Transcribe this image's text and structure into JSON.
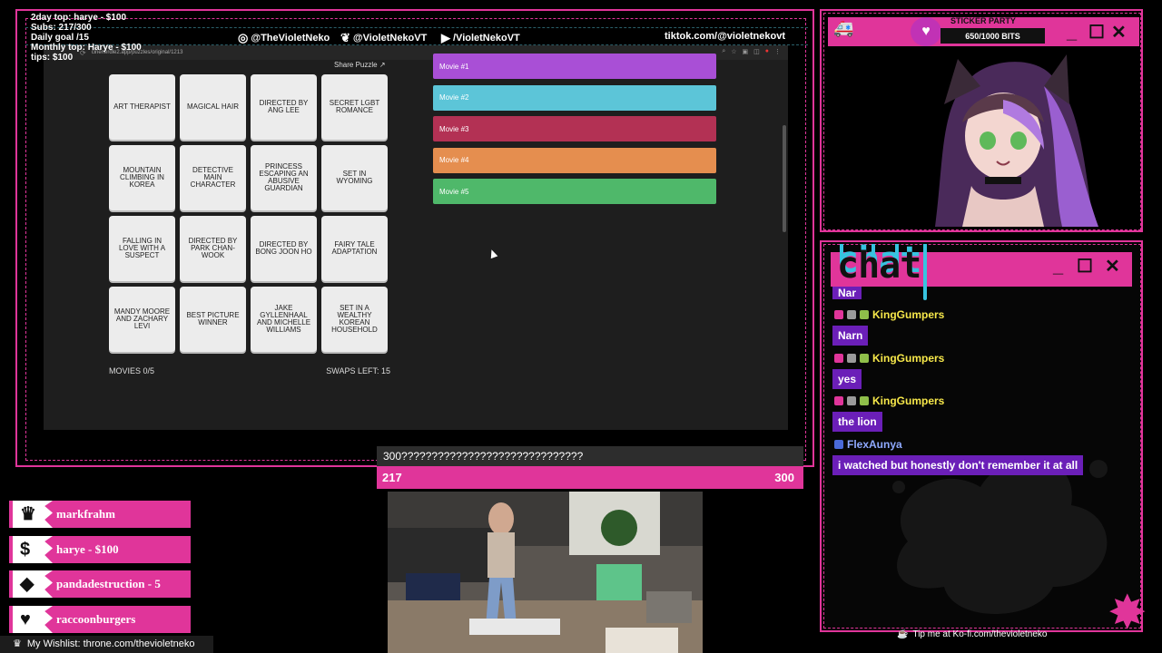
{
  "stats": {
    "lines": [
      "2day top: harye - $100",
      "Subs: 217/300",
      "Daily goal /15",
      "Monthly top: Harye - $100",
      "tips: $100"
    ]
  },
  "socials": {
    "instagram": "@TheVioletNeko",
    "twitter": "@VioletNekoVT",
    "youtube": "/VioletNekoVT",
    "tiktok": "tiktok.com/@violetnekovt"
  },
  "browser": {
    "url": "cinenerdle2.app/puzzles/original/1213",
    "share_label": "Share Puzzle",
    "tiles": [
      "ART THERAPIST",
      "MAGICAL HAIR",
      "DIRECTED BY ANG LEE",
      "SECRET LGBT ROMANCE",
      "MOUNTAIN CLIMBING IN KOREA",
      "DETECTIVE MAIN CHARACTER",
      "PRINCESS ESCAPING AN ABUSIVE GUARDIAN",
      "SET IN WYOMING",
      "FALLING IN LOVE WITH A SUSPECT",
      "DIRECTED BY PARK CHAN-WOOK",
      "DIRECTED BY BONG JOON HO",
      "FAIRY TALE ADAPTATION",
      "MANDY MOORE AND ZACHARY LEVI",
      "BEST PICTURE WINNER",
      "JAKE GYLLENHAAL AND MICHELLE WILLIAMS",
      "SET IN A WEALTHY KOREAN HOUSEHOLD"
    ],
    "movies_count": "MOVIES 0/5",
    "swaps_left": "SWAPS LEFT: 15",
    "movies": [
      {
        "label": "Movie #1",
        "color": "#a94fd6"
      },
      {
        "label": "Movie #2",
        "color": "#5cc5d8"
      },
      {
        "label": "Movie #3",
        "color": "#b33154"
      },
      {
        "label": "Movie #4",
        "color": "#e58e4f"
      },
      {
        "label": "Movie #5",
        "color": "#4fb86a"
      }
    ]
  },
  "sticker": {
    "title": "STICKER PARTY",
    "progress_text": "650/1000 BITS",
    "progress": 0.65
  },
  "chat": {
    "title": "chat",
    "first_msg": "Nar",
    "messages": [
      {
        "user": "KingGumpers",
        "text": "Narn",
        "user_color": "#f7e84a"
      },
      {
        "user": "KingGumpers",
        "text": "yes",
        "user_color": "#f7e84a"
      },
      {
        "user": "KingGumpers",
        "text": "the lion",
        "user_color": "#f7e84a"
      },
      {
        "user": "FlexAunya",
        "text": "i watched but honestly don't remember it at all",
        "user_color": "#8fa9ff"
      }
    ]
  },
  "goal": {
    "label": "300??????????????????????????????",
    "current": "217",
    "target": "300"
  },
  "leaderboard": [
    {
      "icon": "crown-icon",
      "glyph": "♛",
      "text": "markfrahm"
    },
    {
      "icon": "dollar-icon",
      "glyph": "$",
      "text": "harye - $100"
    },
    {
      "icon": "diamond-icon",
      "glyph": "◆",
      "text": "pandadestruction - 5"
    },
    {
      "icon": "heart-icon",
      "glyph": "♥",
      "text": "raccoonburgers"
    }
  ],
  "wishlist": "My Wishlist: throne.com/thevioletneko",
  "kofi": "Tip me at Ko-fi.com/thevioletneko",
  "colors": {
    "accent": "#e0359a",
    "chat_bubble": "#6b1fb8",
    "cyan": "#37c3e0"
  }
}
